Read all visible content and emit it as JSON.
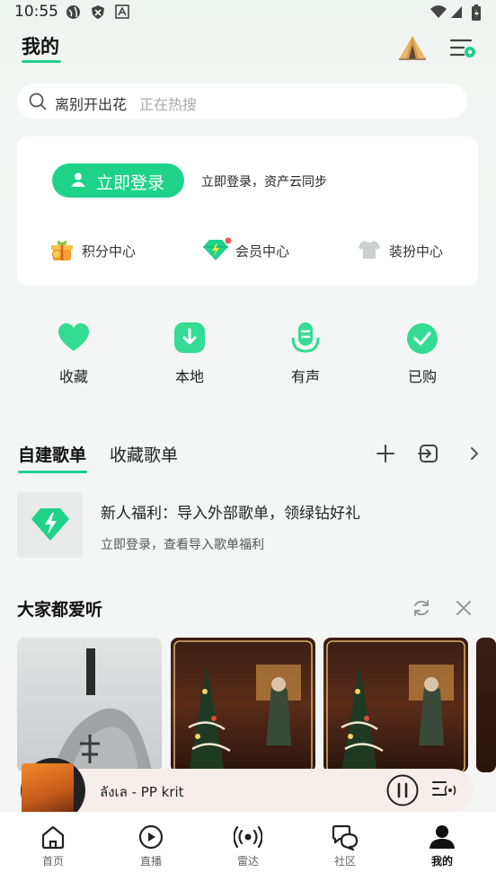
{
  "status_bar": {
    "time": "10:55"
  },
  "header": {
    "title": "我的"
  },
  "search": {
    "query": "离别开出花",
    "hint": "正在热搜"
  },
  "login_card": {
    "login_label": "立即登录",
    "sync_text": "立即登录，资产云同步",
    "centers": [
      "积分中心",
      "会员中心",
      "装扮中心"
    ]
  },
  "quick_items": [
    "收藏",
    "本地",
    "有声",
    "已购"
  ],
  "tabs": {
    "created": "自建歌单",
    "collected": "收藏歌单"
  },
  "promo": {
    "title": "新人福利：导入外部歌单，领绿钻好礼",
    "subtitle": "立即登录，查看导入歌单福利"
  },
  "section": {
    "title": "大家都爱听"
  },
  "mini_player": {
    "title": "ลังเล - PP krit"
  },
  "bottom_nav": [
    "首页",
    "直播",
    "雷达",
    "社区",
    "我的"
  ],
  "colors": {
    "accent": "#1ed28a",
    "background": "#f5f5f5"
  }
}
